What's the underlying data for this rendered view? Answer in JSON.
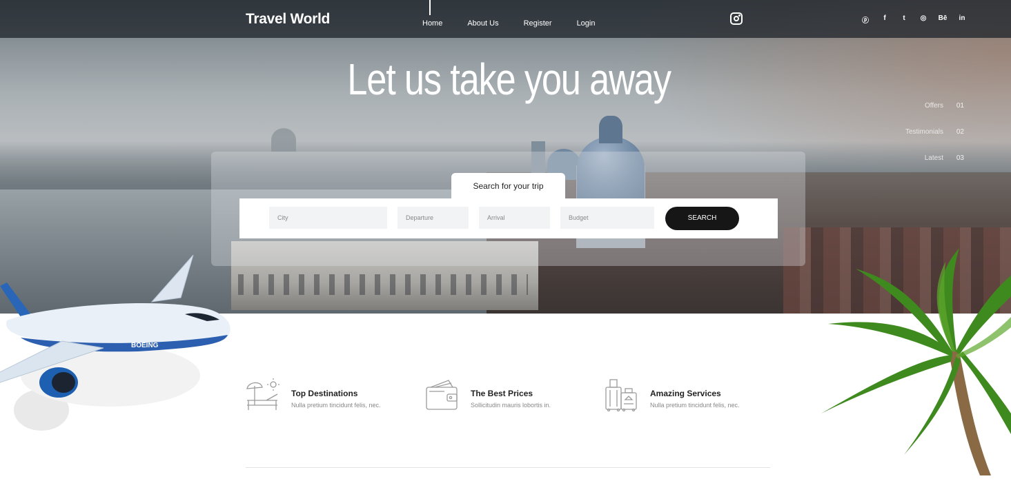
{
  "brand": "Travel World",
  "nav": [
    "Home",
    "About Us",
    "Register",
    "Login"
  ],
  "social": [
    "ⓟ",
    "f",
    "t",
    "◎",
    "Bē",
    "in"
  ],
  "social_names": [
    "pinterest-icon",
    "facebook-icon",
    "twitter-icon",
    "dribbble-icon",
    "behance-icon",
    "linkedin-icon"
  ],
  "hero": {
    "headline": "Let us take you away"
  },
  "side_nav": [
    {
      "label": "Offers",
      "num": "01"
    },
    {
      "label": "Testimonials",
      "num": "02"
    },
    {
      "label": "Latest",
      "num": "03"
    }
  ],
  "search": {
    "tab": "Search for your trip",
    "city": "City",
    "departure": "Departure",
    "arrival": "Arrival",
    "budget": "Budget",
    "button": "SEARCH"
  },
  "features": [
    {
      "title": "Top Destinations",
      "desc": "Nulla pretium tincidunt felis, nec."
    },
    {
      "title": "The Best Prices",
      "desc": "Sollicitudin mauris lobortis in."
    },
    {
      "title": "Amazing Services",
      "desc": "Nulla pretium tincidunt felis, nec."
    }
  ],
  "plane_text": "BOEING",
  "colors": {
    "topbar": "#22282e",
    "button": "#161616",
    "accent": "#ffffff"
  }
}
